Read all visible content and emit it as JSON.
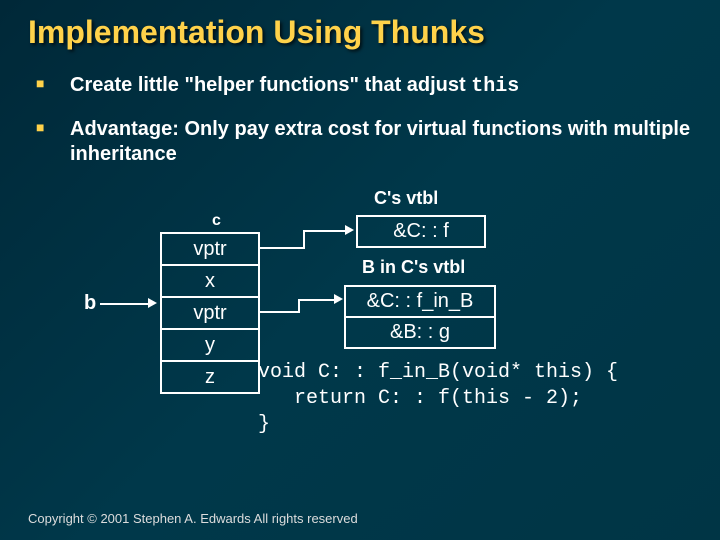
{
  "title": "Implementation Using Thunks",
  "bullets": [
    {
      "pre": "Create little \"helper functions\" that adjust ",
      "code": "this"
    },
    {
      "pre": "Advantage: Only pay extra cost for virtual functions with multiple inheritance",
      "code": ""
    }
  ],
  "diagram": {
    "c_vtbl_label": "C's vtbl",
    "c_label": "c",
    "b_label": "b",
    "object_cells": [
      "vptr",
      "x",
      "vptr",
      "y",
      "z"
    ],
    "vtbl1_cells": [
      "&C: : f"
    ],
    "b_in_c_label": "B in C's vtbl",
    "vtbl2_cells": [
      "&C: : f_in_B",
      "&B: : g"
    ]
  },
  "code_lines": [
    "void C: : f_in_B(void* this) {",
    "   return C: : f(this - 2);",
    "}"
  ],
  "copyright": "Copyright © 2001 Stephen A. Edwards  All rights reserved"
}
